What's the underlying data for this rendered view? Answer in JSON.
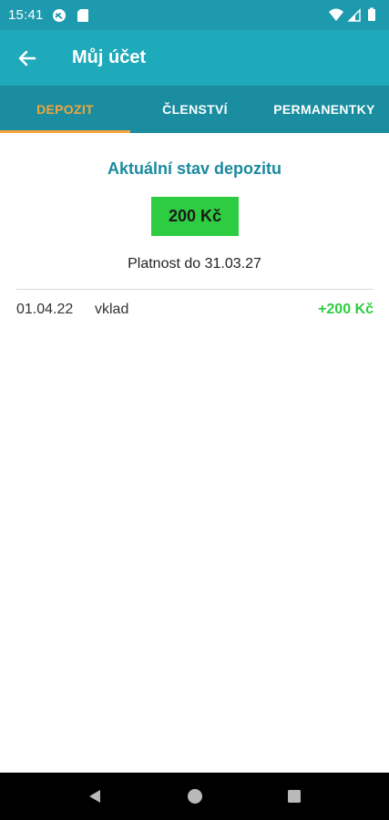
{
  "status_bar": {
    "time": "15:41",
    "icons": [
      "no-disturb-icon",
      "sim-card-icon",
      "wifi-icon",
      "signal-icon",
      "battery-icon"
    ]
  },
  "app_bar": {
    "title": "Můj účet",
    "back_icon": "arrow-left-icon"
  },
  "tabs": [
    {
      "label": "DEPOZIT",
      "active": true
    },
    {
      "label": "ČLENSTVÍ",
      "active": false
    },
    {
      "label": "PERMANENTKY",
      "active": false
    }
  ],
  "deposit": {
    "heading": "Aktuální stav depozitu",
    "amount": "200 Kč",
    "validity": "Platnost do 31.03.27"
  },
  "transactions": [
    {
      "date": "01.04.22",
      "type": "vklad",
      "amount": "+200 Kč"
    }
  ],
  "navigation": {
    "icons": [
      "back-triangle-icon",
      "home-circle-icon",
      "recent-square-icon"
    ]
  },
  "colors": {
    "status_bar": "#1d9aae",
    "app_bar": "#1faabb",
    "tab_bar": "#1a8da0",
    "active_tab": "#f4a43a",
    "heading": "#1b8a9e",
    "amount_box": "#2ecc40",
    "positive_amount": "#2ecc40"
  }
}
